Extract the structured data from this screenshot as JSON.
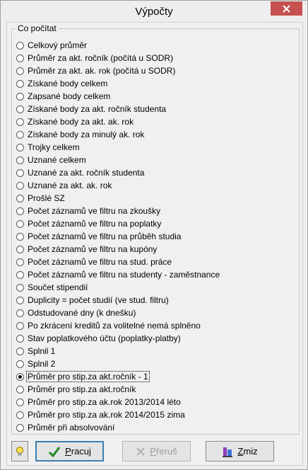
{
  "window": {
    "title": "Výpočty"
  },
  "group": {
    "legend": "Co počítat"
  },
  "options": [
    {
      "label": "Celkový průměr",
      "checked": false
    },
    {
      "label": "Průměr za akt. ročník (počítá u SODR)",
      "checked": false
    },
    {
      "label": "Průměr za akt. ak. rok (počítá u SODR)",
      "checked": false
    },
    {
      "label": "Získané body celkem",
      "checked": false
    },
    {
      "label": "Zapsané body celkem",
      "checked": false
    },
    {
      "label": "Získané body za akt. ročník studenta",
      "checked": false
    },
    {
      "label": "Získané body za akt. ak. rok",
      "checked": false
    },
    {
      "label": "Získané body za minulý ak. rok",
      "checked": false
    },
    {
      "label": "Trojky celkem",
      "checked": false
    },
    {
      "label": "Uznané celkem",
      "checked": false
    },
    {
      "label": "Uznané za akt. ročník studenta",
      "checked": false
    },
    {
      "label": "Uznané za akt. ak. rok",
      "checked": false
    },
    {
      "label": "Prošlé SZ",
      "checked": false
    },
    {
      "label": "Počet záznamů ve filtru na zkoušky",
      "checked": false
    },
    {
      "label": "Počet záznamů ve filtru na poplatky",
      "checked": false
    },
    {
      "label": "Počet záznamů ve filtru na průběh studia",
      "checked": false
    },
    {
      "label": "Počet záznamů ve filtru na kupóny",
      "checked": false
    },
    {
      "label": "Počet záznamů ve filtru na stud. práce",
      "checked": false
    },
    {
      "label": "Počet záznamů ve filtru na studenty - zaměstnance",
      "checked": false
    },
    {
      "label": "Součet stipendií",
      "checked": false
    },
    {
      "label": "Duplicity = počet studií (ve stud. filtru)",
      "checked": false
    },
    {
      "label": "Odstudované dny (k dnešku)",
      "checked": false
    },
    {
      "label": "Po zkrácení kreditů za volitelné nemá splněno",
      "checked": false
    },
    {
      "label": "Stav poplatkového účtu (poplatky-platby)",
      "checked": false
    },
    {
      "label": "Splnil 1",
      "checked": false
    },
    {
      "label": "Splnil 2",
      "checked": false
    },
    {
      "label": "Průměr pro stip.za akt.ročník - 1",
      "checked": true
    },
    {
      "label": "Průměr pro stip.za akt.ročník",
      "checked": false
    },
    {
      "label": "Průměr pro stip.za ak.rok 2013/2014 léto",
      "checked": false
    },
    {
      "label": "Průměr pro stip.za ak.rok 2014/2015 zima",
      "checked": false
    },
    {
      "label": "Průměr při absolvování",
      "checked": false
    }
  ],
  "buttons": {
    "hint_icon": "lightbulb-icon",
    "run": {
      "label_underlined": "P",
      "label_rest": "racuj",
      "icon": "checkmark-icon"
    },
    "interrupt": {
      "label_underlined": "P",
      "label_rest": "řeruš",
      "icon": "x-icon",
      "disabled": true
    },
    "change": {
      "label_underlined": "Z",
      "label_rest": "miz",
      "icon": "change-icon"
    }
  },
  "colors": {
    "close": "#c75050",
    "check_green": "#1f8a1f",
    "disabled_text": "#9a9a9a"
  }
}
